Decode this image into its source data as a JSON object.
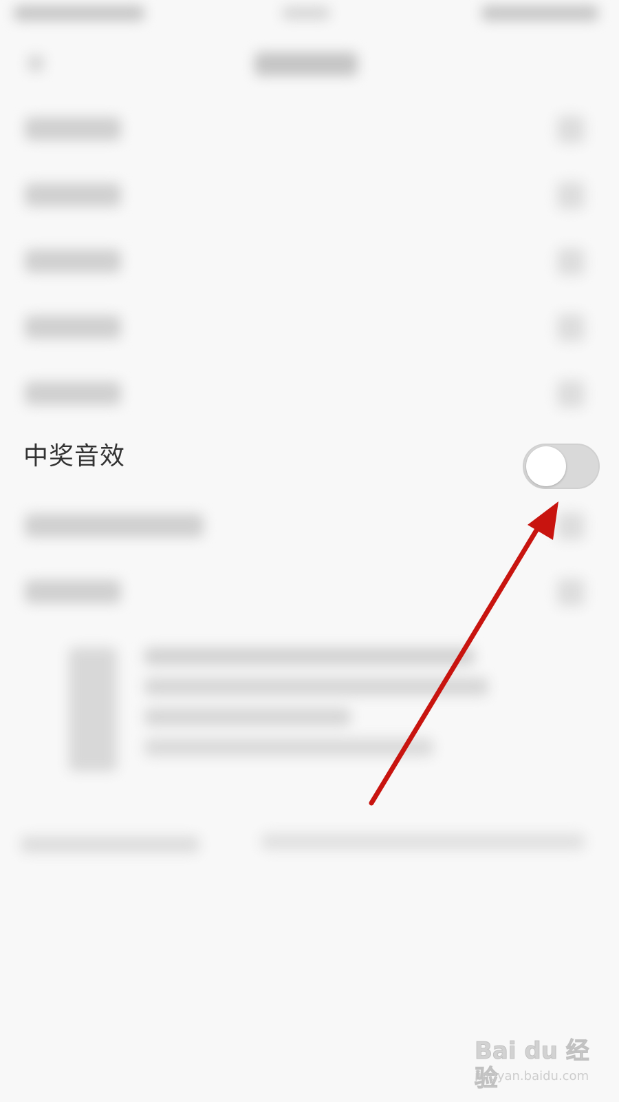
{
  "setting": {
    "label": "中奖音效",
    "toggle_on": false
  },
  "watermark": {
    "logo": "Bai du 经验",
    "url": "jingyan.baidu.com"
  },
  "annotation": {
    "type": "arrow",
    "color": "#c8140f",
    "points_to": "toggle"
  },
  "colors": {
    "background": "#f8f8f8",
    "label_text": "#333333",
    "toggle_track_off": "#d9d9d9",
    "toggle_knob": "#ffffff"
  }
}
